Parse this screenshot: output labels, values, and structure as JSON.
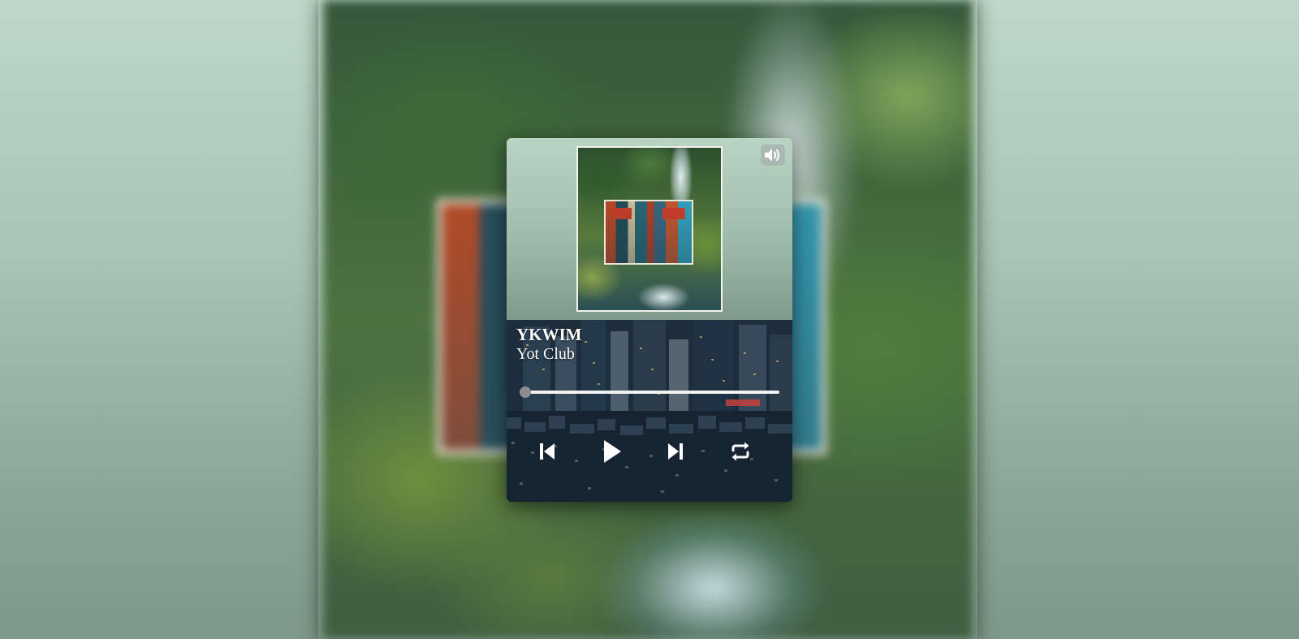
{
  "track": {
    "title": "YKWIM",
    "artist": "Yot Club"
  },
  "playback": {
    "progress_fraction": 0.0,
    "state": "paused"
  },
  "icons": {
    "volume": "volume-icon",
    "previous": "skip-previous-icon",
    "play": "play-icon",
    "next": "skip-next-icon",
    "repeat": "repeat-icon"
  },
  "colors": {
    "progress_track": "#f2f2f2",
    "progress_thumb": "#8c8c8c",
    "icon": "#ffffff"
  }
}
